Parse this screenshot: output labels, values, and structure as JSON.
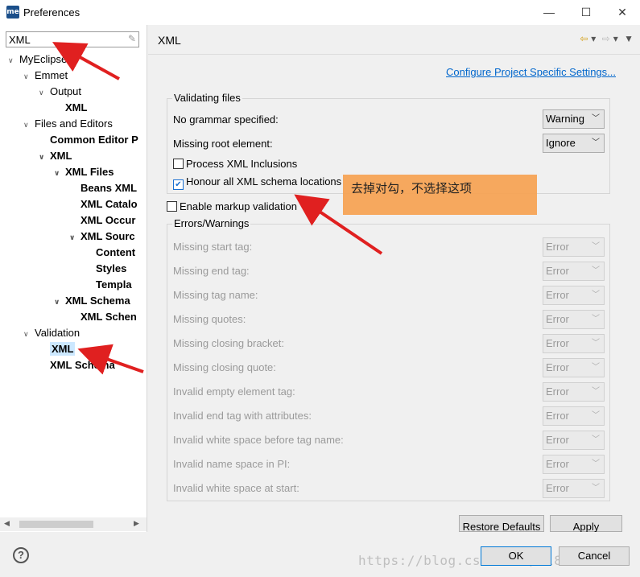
{
  "window": {
    "title": "Preferences",
    "app_icon_text": "me",
    "min": "—",
    "max": "☐",
    "close": "✕"
  },
  "filter": {
    "value": "XML"
  },
  "tree": [
    {
      "label": "MyEclipse",
      "level": 0,
      "twisty": "v",
      "bold": false,
      "selected": false
    },
    {
      "label": "Emmet",
      "level": 1,
      "twisty": "v",
      "bold": false,
      "selected": false
    },
    {
      "label": "Output",
      "level": 2,
      "twisty": "v",
      "bold": false,
      "selected": false
    },
    {
      "label": "XML",
      "level": 3,
      "twisty": "",
      "bold": true,
      "selected": false
    },
    {
      "label": "Files and Editors",
      "level": 1,
      "twisty": "v",
      "bold": false,
      "selected": false
    },
    {
      "label": "Common Editor P",
      "level": 2,
      "twisty": "",
      "bold": true,
      "selected": false
    },
    {
      "label": "XML",
      "level": 2,
      "twisty": "v",
      "bold": true,
      "selected": false
    },
    {
      "label": "XML Files",
      "level": 3,
      "twisty": "v",
      "bold": true,
      "selected": false
    },
    {
      "label": "Beans XML",
      "level": 4,
      "twisty": "",
      "bold": true,
      "selected": false
    },
    {
      "label": "XML Catalo",
      "level": 4,
      "twisty": "",
      "bold": true,
      "selected": false
    },
    {
      "label": "XML Occur",
      "level": 4,
      "twisty": "",
      "bold": true,
      "selected": false
    },
    {
      "label": "XML Sourc",
      "level": 4,
      "twisty": "v",
      "bold": true,
      "selected": false
    },
    {
      "label": "Content",
      "level": 5,
      "twisty": "",
      "bold": true,
      "selected": false
    },
    {
      "label": "Styles",
      "level": 5,
      "twisty": "",
      "bold": true,
      "selected": false
    },
    {
      "label": "Templa",
      "level": 5,
      "twisty": "",
      "bold": true,
      "selected": false
    },
    {
      "label": "XML Schema",
      "level": 3,
      "twisty": "v",
      "bold": true,
      "selected": false
    },
    {
      "label": "XML Schen",
      "level": 4,
      "twisty": "",
      "bold": true,
      "selected": false
    },
    {
      "label": "Validation",
      "level": 1,
      "twisty": "v",
      "bold": false,
      "selected": false
    },
    {
      "label": "XML",
      "level": 2,
      "twisty": "",
      "bold": true,
      "selected": true
    },
    {
      "label": "XML Schema",
      "level": 2,
      "twisty": "",
      "bold": true,
      "selected": false
    }
  ],
  "page": {
    "title": "XML",
    "configure_link": "Configure Project Specific Settings...",
    "validating_files": {
      "label": "Validating files",
      "no_grammar": {
        "label": "No grammar specified:",
        "value": "Warning"
      },
      "missing_root": {
        "label": "Missing root element:",
        "value": "Ignore"
      },
      "process_xinclude": {
        "label": "Process XML Inclusions",
        "checked": false
      },
      "honour_schema": {
        "label": "Honour all XML schema locations",
        "checked": true
      }
    },
    "markup_validation": {
      "label": "Enable markup validation",
      "checked": false
    },
    "errors_warnings": {
      "label": "Errors/Warnings",
      "items": [
        {
          "label": "Missing start tag:",
          "value": "Error"
        },
        {
          "label": "Missing end tag:",
          "value": "Error"
        },
        {
          "label": "Missing tag name:",
          "value": "Error"
        },
        {
          "label": "Missing quotes:",
          "value": "Error"
        },
        {
          "label": "Missing closing bracket:",
          "value": "Error"
        },
        {
          "label": "Missing closing quote:",
          "value": "Error"
        },
        {
          "label": "Invalid empty element tag:",
          "value": "Error"
        },
        {
          "label": "Invalid end tag with attributes:",
          "value": "Error"
        },
        {
          "label": "Invalid white space before tag name:",
          "value": "Error"
        },
        {
          "label": "Invalid name space in PI:",
          "value": "Error"
        },
        {
          "label": "Invalid white space at start:",
          "value": "Error"
        }
      ]
    },
    "restore_defaults": "Restore Defaults",
    "apply": "Apply"
  },
  "bottom": {
    "ok": "OK",
    "cancel": "Cancel",
    "help": "?"
  },
  "annotation": {
    "note": "去掉对勾，不选择这项",
    "color": "#f6a355"
  },
  "watermark": "https://blog.csdn.net/ml863606874"
}
